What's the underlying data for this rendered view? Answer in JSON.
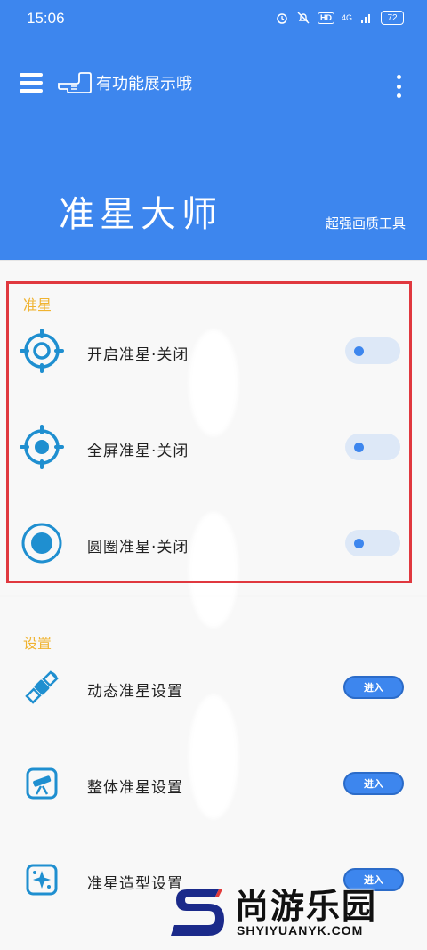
{
  "status_bar": {
    "time": "15:06",
    "icons": [
      "alarm-icon",
      "mute-bell-icon",
      "hd-icon",
      "signal-icon"
    ],
    "hd_label": "HD",
    "network_label": "4G",
    "battery": "72"
  },
  "header": {
    "hint_text": "有功能展示哦",
    "title": "准星大师",
    "subtitle": "超强画质工具"
  },
  "crosshair_section": {
    "label": "准星",
    "items": [
      {
        "label": "开启准星·关闭",
        "icon": "target-ring-icon",
        "toggle_on": false
      },
      {
        "label": "全屏准星·关闭",
        "icon": "target-dot-icon",
        "toggle_on": false
      },
      {
        "label": "圆圈准星·关闭",
        "icon": "circle-dot-icon",
        "toggle_on": false
      }
    ]
  },
  "settings_section": {
    "label": "设置",
    "items": [
      {
        "label": "动态准星设置",
        "icon": "satellite-icon",
        "button": "进入"
      },
      {
        "label": "整体准星设置",
        "icon": "telescope-icon",
        "button": "进入"
      },
      {
        "label": "准星造型设置",
        "icon": "sparkle-icon",
        "button": "进入"
      }
    ]
  },
  "watermark": {
    "text": "尚游乐园",
    "url": "SHYIYUANYK.COM"
  },
  "colors": {
    "primary": "#3d86ee",
    "section_label": "#f0b330",
    "highlight": "#e0383f",
    "icon": "#1f8fd0"
  }
}
